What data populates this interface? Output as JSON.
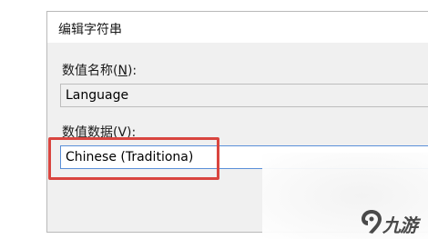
{
  "dialog": {
    "title": "编辑字符串",
    "value_name": {
      "label_prefix": "数值名称(",
      "label_key": "N",
      "label_suffix": "):",
      "value": "Language"
    },
    "value_data": {
      "label_prefix": "数值数据(",
      "label_key": "V",
      "label_suffix": "):",
      "value": "Chinese (Traditiona)"
    }
  },
  "annotation": {
    "highlight_color": "#d9453f"
  },
  "watermark": {
    "text": "九游",
    "icon": "jiuyou-logo-icon"
  }
}
